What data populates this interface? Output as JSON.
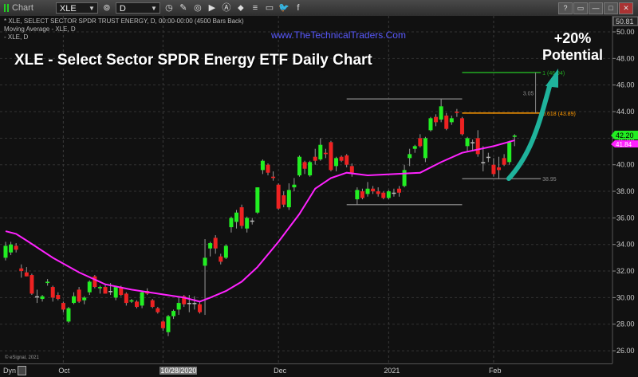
{
  "toolbar": {
    "app_label": "Chart",
    "symbol": "XLE",
    "interval": "D",
    "window_buttons": [
      "?",
      "▭",
      "—",
      "□",
      "✕"
    ]
  },
  "legend": {
    "line1": "* XLE, SELECT SECTOR SPDR TRUST ENERGY, D, 00:00-00:00 (4500 Bars Back)",
    "line2": "Moving Average - XLE, D",
    "line3": " - XLE, D"
  },
  "overlay": {
    "website": "www.TheTechnicalTraders.Com",
    "title": "XLE - Select Sector SPDR Energy ETF Daily Chart",
    "potential_pct": "+20%",
    "potential_label": "Potential"
  },
  "footer": {
    "copyright": "© eSignal, 2021",
    "dyn": "Dyn"
  },
  "colors": {
    "up": "#22ee22",
    "down": "#ee2222",
    "ma": "#ff22ff",
    "arrow": "#1fb39c",
    "fib1": "#22aa22",
    "fib618": "#ff9900",
    "level": "#777777"
  },
  "chart_data": {
    "type": "candlestick",
    "title": "XLE - Select Sector SPDR Energy ETF Daily Chart",
    "ylim": [
      25.5,
      51
    ],
    "y_ticks": [
      "50.00",
      "48.00",
      "46.00",
      "44.00",
      "42.00",
      "40.00",
      "38.00",
      "36.00",
      "34.00",
      "32.00",
      "30.00",
      "28.00",
      "26.00"
    ],
    "y_top_label": "50.81",
    "x_labels": [
      {
        "label": "Oct",
        "bar": 11
      },
      {
        "label": "10/28/2020",
        "bar": 30,
        "highlight": true
      },
      {
        "label": "Dec",
        "bar": 52
      },
      {
        "label": "2021",
        "bar": 73
      },
      {
        "label": "Feb",
        "bar": 93
      }
    ],
    "last_price": "42.20",
    "ma_last": "41.84",
    "ohlc": [
      [
        33.0,
        34.2,
        32.8,
        33.9
      ],
      [
        33.4,
        34.2,
        33.2,
        34.0
      ],
      [
        33.9,
        34.1,
        33.4,
        33.6
      ],
      [
        32.2,
        32.5,
        31.5,
        32.0
      ],
      [
        31.9,
        32.3,
        31.6,
        31.6
      ],
      [
        31.7,
        31.8,
        30.2,
        30.3
      ],
      [
        30.1,
        30.6,
        29.6,
        30.1
      ],
      [
        29.9,
        30.2,
        29.7,
        30.1
      ],
      [
        31.1,
        31.4,
        30.9,
        31.2
      ],
      [
        30.8,
        30.9,
        29.7,
        30.0
      ],
      [
        30.2,
        30.4,
        29.8,
        29.9
      ],
      [
        29.6,
        29.7,
        28.9,
        29.1
      ],
      [
        28.2,
        29.3,
        28.1,
        29.2
      ],
      [
        29.6,
        30.4,
        29.5,
        30.1
      ],
      [
        30.6,
        30.8,
        29.6,
        29.7
      ],
      [
        29.8,
        30.1,
        29.5,
        30.0
      ],
      [
        30.4,
        31.3,
        30.2,
        31.2
      ],
      [
        31.6,
        31.7,
        30.7,
        30.8
      ],
      [
        30.7,
        30.9,
        30.3,
        30.8
      ],
      [
        30.8,
        31.0,
        30.3,
        30.3
      ],
      [
        30.5,
        31.1,
        30.2,
        30.5
      ],
      [
        30.0,
        30.9,
        29.8,
        30.8
      ],
      [
        30.8,
        30.9,
        30.1,
        30.2
      ],
      [
        30.3,
        30.4,
        29.4,
        29.6
      ],
      [
        29.7,
        29.9,
        29.6,
        29.8
      ],
      [
        29.7,
        29.8,
        29.2,
        29.3
      ],
      [
        29.4,
        30.5,
        29.2,
        30.4
      ],
      [
        30.5,
        30.7,
        30.2,
        30.3
      ],
      [
        29.8,
        29.9,
        29.2,
        29.3
      ],
      [
        29.2,
        29.3,
        28.8,
        28.9
      ],
      [
        28.2,
        28.3,
        27.5,
        27.7
      ],
      [
        27.4,
        28.7,
        27.1,
        28.6
      ],
      [
        28.6,
        29.1,
        28.4,
        29.0
      ],
      [
        29.1,
        30.0,
        28.7,
        29.6
      ],
      [
        30.1,
        30.2,
        29.3,
        29.5
      ],
      [
        29.6,
        30.2,
        28.9,
        29.6
      ],
      [
        29.6,
        30.1,
        29.1,
        29.6
      ],
      [
        29.5,
        29.7,
        28.8,
        28.9
      ],
      [
        32.4,
        34.4,
        28.7,
        33.0
      ],
      [
        33.7,
        34.2,
        33.1,
        34.1
      ],
      [
        34.5,
        34.7,
        33.3,
        33.7
      ],
      [
        33.1,
        33.3,
        32.5,
        32.7
      ],
      [
        33.0,
        34.0,
        32.9,
        33.9
      ],
      [
        35.3,
        36.1,
        34.9,
        36.0
      ],
      [
        35.7,
        36.6,
        35.2,
        36.4
      ],
      [
        36.8,
        37.0,
        35.2,
        35.4
      ],
      [
        35.2,
        36.1,
        34.9,
        36.0
      ],
      [
        35.8,
        36.0,
        35.5,
        35.8
      ],
      [
        36.4,
        38.3,
        36.3,
        38.3
      ],
      [
        39.6,
        40.4,
        39.3,
        40.3
      ],
      [
        40.0,
        40.1,
        39.2,
        39.4
      ],
      [
        39.1,
        39.5,
        38.8,
        39.0
      ],
      [
        38.5,
        38.6,
        36.6,
        36.7
      ],
      [
        37.7,
        38.0,
        36.8,
        37.0
      ],
      [
        36.8,
        38.6,
        36.6,
        38.1
      ],
      [
        38.3,
        39.0,
        38.0,
        38.5
      ],
      [
        39.2,
        40.7,
        39.1,
        40.6
      ],
      [
        40.2,
        40.3,
        39.3,
        39.7
      ],
      [
        39.2,
        40.3,
        39.1,
        40.2
      ],
      [
        40.6,
        41.2,
        40.0,
        40.3
      ],
      [
        40.4,
        42.0,
        40.3,
        41.5
      ],
      [
        40.9,
        41.2,
        40.5,
        40.8
      ],
      [
        41.7,
        41.8,
        39.5,
        39.6
      ],
      [
        39.9,
        40.6,
        39.5,
        40.5
      ],
      [
        40.6,
        40.7,
        40.2,
        40.3
      ],
      [
        40.7,
        40.8,
        39.8,
        40.0
      ],
      [
        39.9,
        40.1,
        39.1,
        39.4
      ],
      [
        37.4,
        38.3,
        37.0,
        38.1
      ],
      [
        38.0,
        38.2,
        37.4,
        37.5
      ],
      [
        37.8,
        38.7,
        37.6,
        38.2
      ],
      [
        38.2,
        38.4,
        37.8,
        38.0
      ],
      [
        38.0,
        38.3,
        37.6,
        37.8
      ],
      [
        37.9,
        38.0,
        37.4,
        37.5
      ],
      [
        37.5,
        38.1,
        37.4,
        38.0
      ],
      [
        37.9,
        38.2,
        37.6,
        37.9
      ],
      [
        38.2,
        38.4,
        37.6,
        37.9
      ],
      [
        38.4,
        40.0,
        38.3,
        39.6
      ],
      [
        40.5,
        41.2,
        39.9,
        40.8
      ],
      [
        41.2,
        41.5,
        40.9,
        41.4
      ],
      [
        42.0,
        42.3,
        41.3,
        41.4
      ],
      [
        40.5,
        42.1,
        40.2,
        42.0
      ],
      [
        42.6,
        43.6,
        42.5,
        43.5
      ],
      [
        43.6,
        43.8,
        42.9,
        43.2
      ],
      [
        43.4,
        44.95,
        43.2,
        44.4
      ],
      [
        43.7,
        43.9,
        42.6,
        42.7
      ],
      [
        43.2,
        43.7,
        43.0,
        43.5
      ],
      [
        44.0,
        44.2,
        43.6,
        43.9
      ],
      [
        43.5,
        43.6,
        42.2,
        42.3
      ],
      [
        41.4,
        42.1,
        41.0,
        42.0
      ],
      [
        41.7,
        41.9,
        41.0,
        41.7
      ],
      [
        42.0,
        42.6,
        40.6,
        40.8
      ],
      [
        40.2,
        41.4,
        39.5,
        40.2
      ],
      [
        40.6,
        40.9,
        40.2,
        40.6
      ],
      [
        40.0,
        40.5,
        39.1,
        39.3
      ],
      [
        39.8,
        40.6,
        38.95,
        39.6
      ],
      [
        40.5,
        40.8,
        39.9,
        40.0
      ],
      [
        40.2,
        41.8,
        40.0,
        41.7
      ],
      [
        42.1,
        42.3,
        41.4,
        42.2
      ]
    ],
    "moving_average": {
      "name": "Moving Average - XLE, D",
      "points": [
        [
          0,
          35.0
        ],
        [
          2,
          34.8
        ],
        [
          4,
          34.3
        ],
        [
          9,
          33.0
        ],
        [
          14,
          31.9
        ],
        [
          19,
          31.0
        ],
        [
          24,
          30.6
        ],
        [
          29,
          30.3
        ],
        [
          34,
          30.0
        ],
        [
          37,
          29.7
        ],
        [
          39,
          30.0
        ],
        [
          42,
          30.5
        ],
        [
          45,
          31.2
        ],
        [
          48,
          32.3
        ],
        [
          52,
          34.2
        ],
        [
          56,
          36.3
        ],
        [
          59,
          38.2
        ],
        [
          62,
          39.0
        ],
        [
          65,
          39.4
        ],
        [
          69,
          39.2
        ],
        [
          74,
          39.3
        ],
        [
          79,
          39.4
        ],
        [
          83,
          40.2
        ],
        [
          87,
          40.9
        ],
        [
          93,
          41.4
        ],
        [
          97,
          41.84
        ]
      ]
    },
    "annotations": {
      "fib_1": {
        "label": "1 (46.94)",
        "value": 46.94,
        "from_bar": 87,
        "to_bar": 102
      },
      "fib_618": {
        "label": "0.618 (43.89)",
        "value": 43.89,
        "from_bar": 87,
        "to_bar": 102
      },
      "range_high": {
        "value": 44.95,
        "from_bar": 65,
        "to_bar": 87
      },
      "range_low": {
        "value": 37.0,
        "from_bar": 65,
        "to_bar": 87
      },
      "swing_low": {
        "label": "38.95",
        "value": 38.95,
        "from_bar": 87,
        "to_bar": 102
      },
      "measure": {
        "label": "3.05",
        "bar": 101,
        "from": 43.89,
        "to": 46.94
      }
    }
  }
}
